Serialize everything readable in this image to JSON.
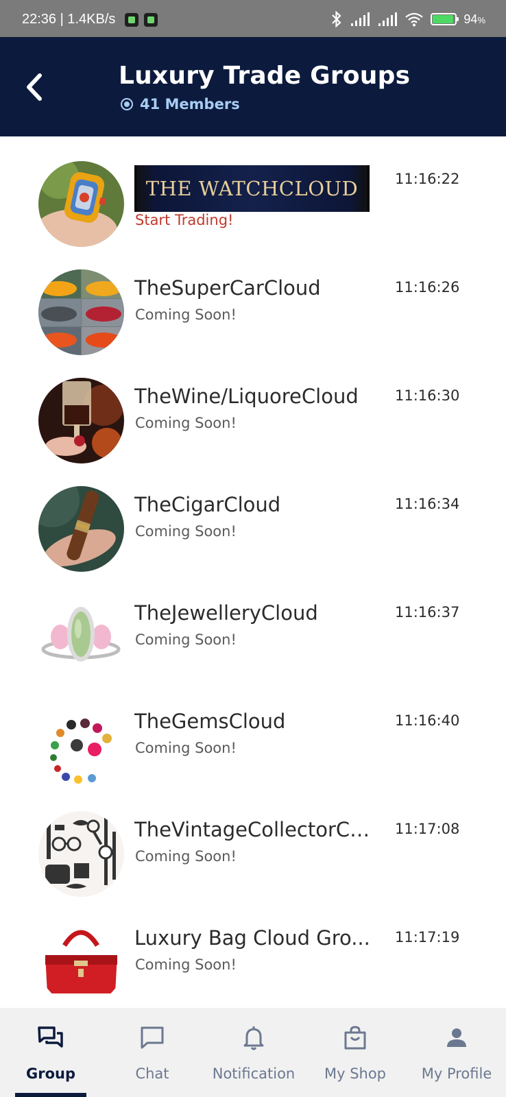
{
  "status_bar": {
    "time_speed": "22:36 | 1.4KB/s",
    "battery_percent": "94",
    "battery_unit": "%",
    "battery_level": 0.94
  },
  "header": {
    "title": "Luxury Trade Groups",
    "members": "41 Members",
    "back_icon": "chevron-left-icon"
  },
  "groups": [
    {
      "name": "",
      "banner_text": "THE WATCHCLOUD",
      "subtitle": "Start Trading!",
      "time": "11:16:22",
      "avatar": "watch"
    },
    {
      "name": "TheSuperCarCloud",
      "subtitle": "Coming Soon!",
      "time": "11:16:26",
      "avatar": "cars"
    },
    {
      "name": "TheWine/LiquoreCloud",
      "subtitle": "Coming Soon!",
      "time": "11:16:30",
      "avatar": "wine"
    },
    {
      "name": "TheCigarCloud",
      "subtitle": "Coming Soon!",
      "time": "11:16:34",
      "avatar": "cigar"
    },
    {
      "name": "TheJewelleryCloud",
      "subtitle": "Coming Soon!",
      "time": "11:16:37",
      "avatar": "ring"
    },
    {
      "name": "TheGemsCloud",
      "subtitle": "Coming Soon!",
      "time": "11:16:40",
      "avatar": "gems"
    },
    {
      "name": "TheVintageCollectorCl...",
      "subtitle": "Coming Soon!",
      "time": "11:17:08",
      "avatar": "vintage"
    },
    {
      "name": "Luxury Bag Cloud Gro...",
      "subtitle": "Coming Soon!",
      "time": "11:17:19",
      "avatar": "bag"
    }
  ],
  "tabs": [
    {
      "label": "Group",
      "icon": "group-chat-icon",
      "active": true
    },
    {
      "label": "Chat",
      "icon": "chat-bubble-icon",
      "active": false
    },
    {
      "label": "Notification",
      "icon": "bell-icon",
      "active": false
    },
    {
      "label": "My Shop",
      "icon": "shopping-bag-icon",
      "active": false
    },
    {
      "label": "My Profile",
      "icon": "person-icon",
      "active": false
    }
  ],
  "colors": {
    "header_bg": "#0c1b3d",
    "accent_light": "#a9cdf5",
    "start_trading": "#c0392b",
    "tab_inactive": "#6b7890"
  }
}
